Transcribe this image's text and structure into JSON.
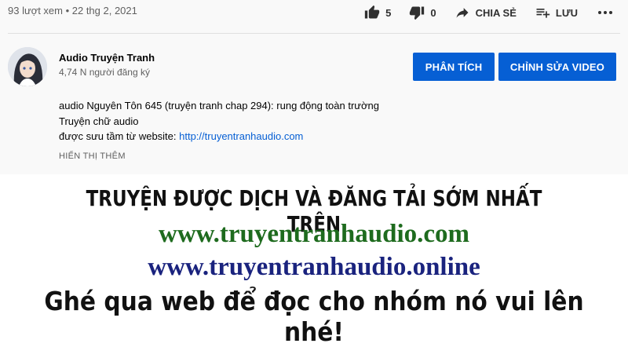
{
  "video_meta": {
    "views_date": "93 lượt xem • 22 thg 2, 2021"
  },
  "actions": {
    "like_count": "5",
    "dislike_count": "0",
    "share_label": "CHIA SẺ",
    "save_label": "LƯU"
  },
  "channel": {
    "name": "Audio Truyện Tranh",
    "subscribers": "4,74 N người đăng ký"
  },
  "buttons": {
    "analyze": "PHÂN TÍCH",
    "edit_video": "CHỈNH SỬA VIDEO"
  },
  "description": {
    "line1": "audio Nguyên Tôn 645 (truyện tranh chap 294): rung động toàn trường",
    "line2": "Truyện chữ audio",
    "line3_prefix": "được sưu tầm từ website: ",
    "line3_link": "http://truyentranhaudio.com",
    "show_more": "HIỂN THỊ THÊM"
  },
  "banner": {
    "line1": "TRUYỆN ĐƯỢC DỊCH VÀ ĐĂNG TẢI SỚM NHẤT TRÊN",
    "line2": "www.truyentranhaudio.com",
    "line3": "www.truyentranhaudio.online",
    "line4": "Ghé qua web để đọc cho nhóm nó vui lên nhé!"
  },
  "colors": {
    "accent": "#065fd4",
    "banner_green": "#1e6b1e",
    "banner_navy": "#1a237e"
  }
}
